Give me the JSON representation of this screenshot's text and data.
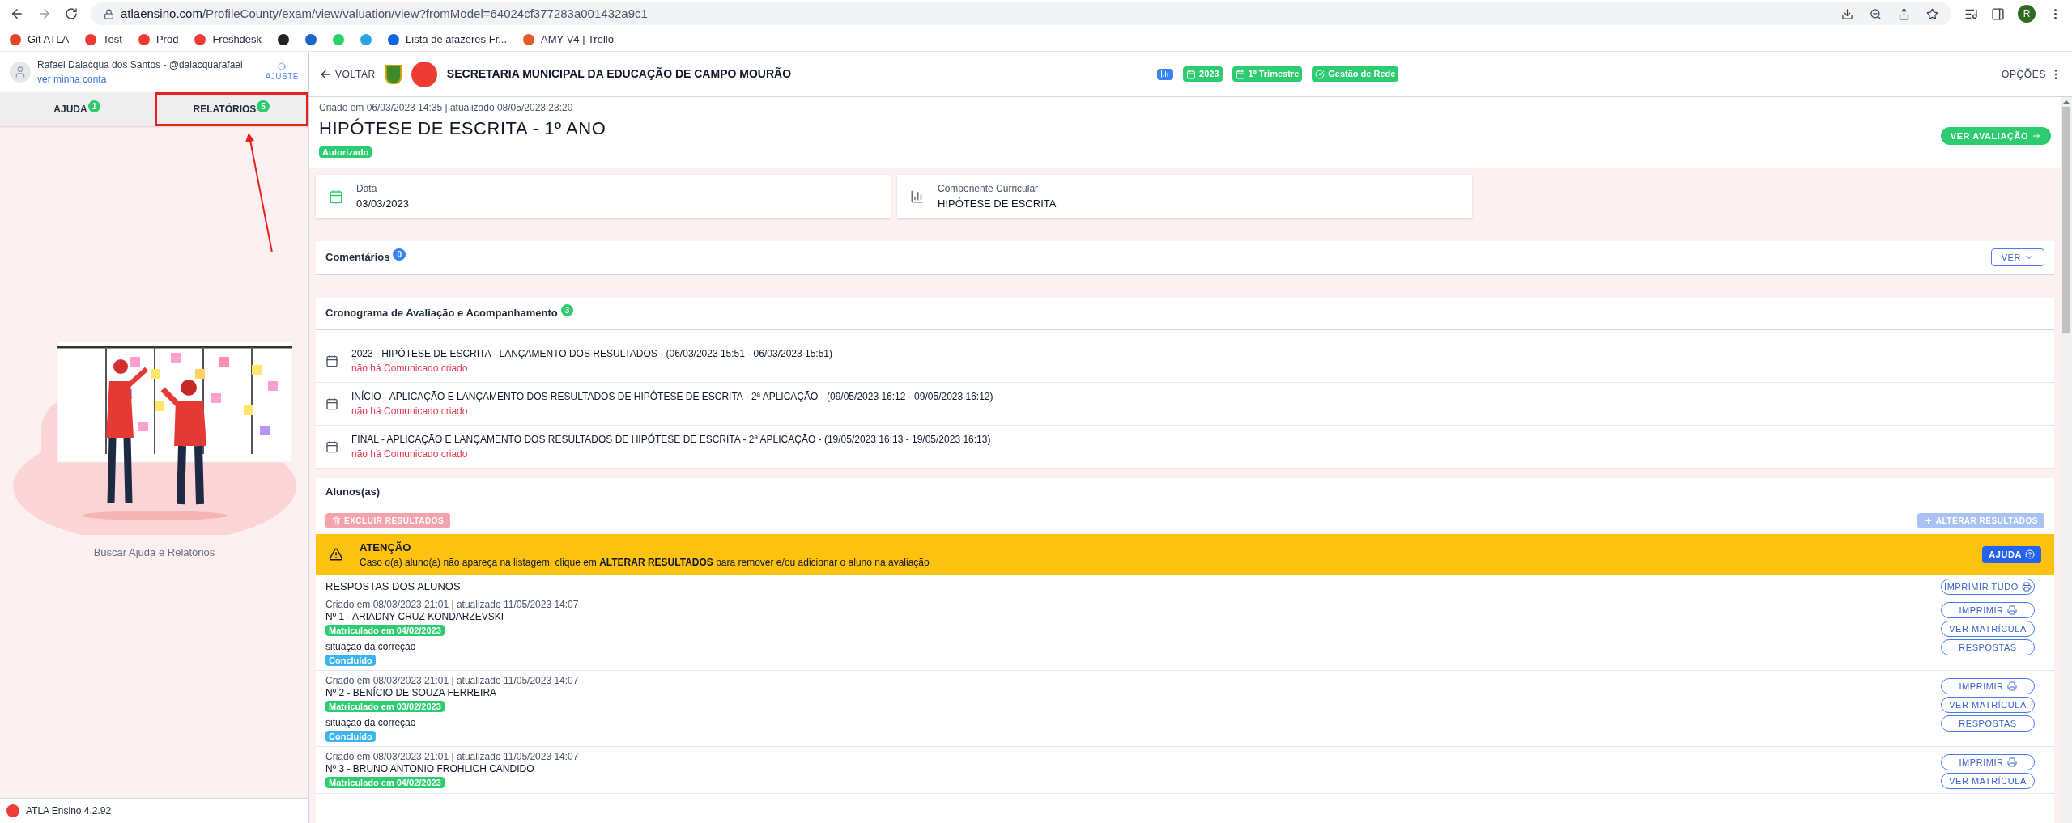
{
  "browser": {
    "url_host": "atlaensino.com",
    "url_path": "/ProfileCounty/exam/view/valuation/view?fromModel=64024cf377283a001432a9c1",
    "profile_initial": "R",
    "bookmarks": [
      {
        "label": "Git ATLA",
        "color": "#e24329"
      },
      {
        "label": "Test",
        "color": "#ef3b36"
      },
      {
        "label": "Prod",
        "color": "#ef3b36"
      },
      {
        "label": "Freshdesk",
        "color": "#ef3b36"
      },
      {
        "color": "#222222"
      },
      {
        "color": "#1e64c8"
      },
      {
        "color": "#25d366"
      },
      {
        "color": "#2aa3e0"
      },
      {
        "label": "Lista de afazeres Fr...",
        "color": "#0c66e4"
      },
      {
        "label": "AMY V4 | Trello",
        "color": "#e35d2b"
      }
    ]
  },
  "sidebar": {
    "user": "Rafael Dalacqua dos Santos - @dalacquarafael",
    "account_link": "ver minha conta",
    "settings": "AJUSTE",
    "tabs": [
      {
        "label": "AJUDA",
        "count": "1",
        "highlighted": false
      },
      {
        "label": "RELATÓRIOS",
        "count": "5",
        "highlighted": true
      }
    ],
    "caption": "Buscar Ajuda e Relatórios",
    "version": "ATLA Ensino 4.2.92"
  },
  "header": {
    "back": "VOLTAR",
    "org": "SECRETARIA MUNICIPAL DA EDUCAÇÃO DE CAMPO MOURÃO",
    "chips": [
      {
        "kind": "chart",
        "color": "#3b82f6"
      },
      {
        "label": "2023",
        "kind": "calendar",
        "color": "#2ecc71"
      },
      {
        "label": "1º Trimestre",
        "kind": "calendar",
        "color": "#2ecc71"
      },
      {
        "label": "Gestão de Rede",
        "kind": "check",
        "color": "#2ecc71"
      }
    ],
    "options": "OPÇÕES"
  },
  "evaluation": {
    "meta": "Criado em 06/03/2023 14:35 | atualizado 08/05/2023 23:20",
    "title": "HIPÓTESE DE ESCRITA - 1º ANO",
    "status": "Autorizado",
    "view_button": "VER AVALIAÇÃO"
  },
  "info_cards": [
    {
      "label": "Data",
      "value": "03/03/2023",
      "kind": "calendar"
    },
    {
      "label": "Componente Curricular",
      "value": "HIPÓTESE DE ESCRITA",
      "kind": "chart"
    }
  ],
  "comments": {
    "title": "Comentários",
    "count": "0",
    "button": "VER"
  },
  "schedule": {
    "title": "Cronograma de Avaliação e Acompanhamento",
    "count": "3",
    "items": [
      {
        "title": "2023 - HIPÓTESE DE ESCRITA - LANÇAMENTO DOS RESULTADOS - (06/03/2023 15:51 - 06/03/2023 15:51)",
        "note": "não há Comunicado criado"
      },
      {
        "title": "INÍCIO - APLICAÇÃO E LANÇAMENTO DOS RESULTADOS DE HIPÓTESE DE ESCRITA - 2ª APLICAÇÃO - (09/05/2023 16:12 - 09/05/2023 16:12)",
        "note": "não há Comunicado criado"
      },
      {
        "title": "FINAL - APLICAÇÃO E LANÇAMENTO DOS RESULTADOS DE HIPÓTESE DE ESCRITA - 2ª APLICAÇÃO - (19/05/2023 16:13 - 19/05/2023 16:13)",
        "note": "não há Comunicado criado"
      }
    ]
  },
  "students": {
    "title": "Alunos(as)",
    "delete_button": {
      "label": "EXCLUIR RESULTADOS",
      "disabled": true
    },
    "change_button": {
      "label": "ALTERAR RESULTADOS",
      "disabled": true
    },
    "alert": {
      "title": "ATENÇÃO",
      "text": "Caso o(a) aluno(a) não apareça na listagem, clique em **ALTERAR RESULTADOS** para remover e/ou adicionar o aluno na avaliação",
      "button": "AJUDA"
    },
    "answers_title": "RESPOSTAS DOS ALUNOS",
    "print_all": "IMPRIMIR TUDO",
    "items": [
      {
        "meta": "Criado em 08/03/2023 21:01 | atualizado 11/05/2023 14:07",
        "name": "Nº 1 - ARIADNY CRUZ KONDARZEVSKI",
        "enrolled": "Matriculado em 04/02/2023",
        "status_label": "situação da correção",
        "status": "Concluído",
        "buttons": [
          "IMPRIMIR",
          "VER MATRÍCULA",
          "RESPOSTAS"
        ]
      },
      {
        "meta": "Criado em 08/03/2023 21:01 | atualizado 11/05/2023 14:07",
        "name": "Nº 2 - BENÍCIO DE SOUZA FERREIRA",
        "enrolled": "Matriculado em 03/02/2023",
        "status_label": "situação da correção",
        "status": "Concluído",
        "buttons": [
          "IMPRIMIR",
          "VER MATRÍCULA",
          "RESPOSTAS"
        ]
      },
      {
        "meta": "Criado em 08/03/2023 21:01 | atualizado 11/05/2023 14:07",
        "name": "Nº 3 - BRUNO ANTONIO FROHLICH CANDIDO",
        "enrolled": "Matriculado em 04/02/2023",
        "buttons": [
          "IMPRIMIR",
          "VER MATRÍCULA"
        ]
      }
    ]
  }
}
